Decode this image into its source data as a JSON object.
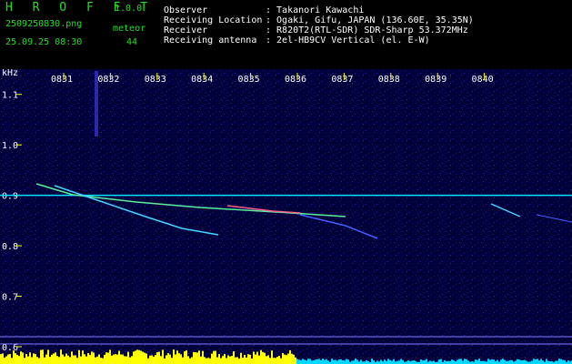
{
  "app": {
    "brand": "H R O F F T",
    "version": "1.0.0",
    "filename": "2509250830.png",
    "datetime": "25.09.25 08:30",
    "meteor_label": "meteor",
    "meteor_count": "44"
  },
  "info": [
    {
      "key": "Observer",
      "value": ": Takanori Kawachi"
    },
    {
      "key": "Receiving Location",
      "value": ": Ogaki, Gifu, JAPAN (136.60E, 35.35N)"
    },
    {
      "key": "Receiver",
      "value": ": R820T2(RTL-SDR) SDR-Sharp 53.372MHz"
    },
    {
      "key": "Receiving antenna",
      "value": ": 2el-HB9CV Vertical (el. E-W)"
    }
  ],
  "chart_data": {
    "type": "heatmap",
    "ylabel": "kHz",
    "x_ticks": [
      "0831",
      "0832",
      "0833",
      "0834",
      "0835",
      "0836",
      "0837",
      "0838",
      "0839",
      "0840"
    ],
    "y_ticks": [
      "1.1",
      "1.0",
      "0.9",
      "0.8",
      "0.7",
      "0.6"
    ],
    "ylim": [
      0.6,
      1.15
    ],
    "carrier_khz": 0.9,
    "colors": {
      "background": "#000040",
      "tick": "#ffff00",
      "label": "#ffffff",
      "bars": "#ffff00",
      "bars_low": "#00d8ff"
    }
  }
}
